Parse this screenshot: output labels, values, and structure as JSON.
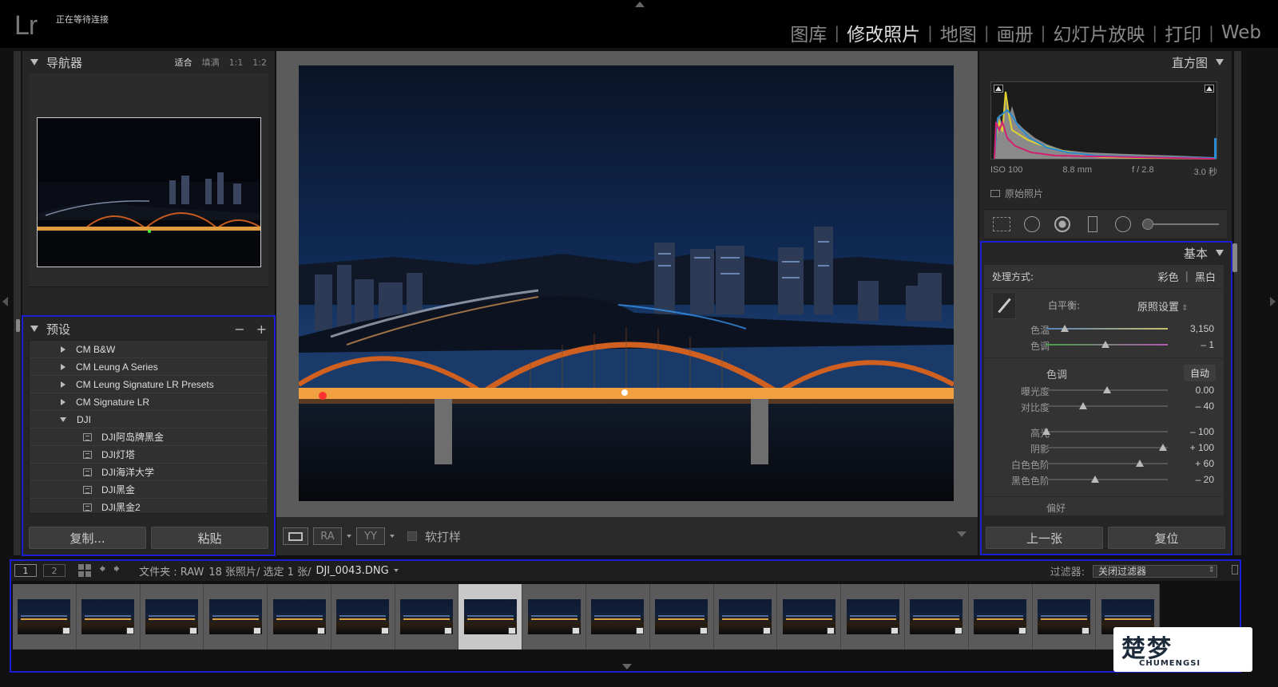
{
  "app": {
    "logo": "Lr",
    "identity_status": "正在等待连接"
  },
  "modules": [
    {
      "label": "图库",
      "active": false
    },
    {
      "label": "修改照片",
      "active": true
    },
    {
      "label": "地图",
      "active": false
    },
    {
      "label": "画册",
      "active": false
    },
    {
      "label": "幻灯片放映",
      "active": false
    },
    {
      "label": "打印",
      "active": false
    },
    {
      "label": "Web",
      "active": false
    }
  ],
  "navigator": {
    "title": "导航器",
    "zoom_fit": "适合",
    "zoom_fill": "填满",
    "zoom_1_1": "1:1",
    "zoom_1_2": "1:2",
    "zoom_caret": "⇕"
  },
  "presets": {
    "title": "预设",
    "remove": "−",
    "add": "+",
    "items": [
      {
        "label": "CM B&W",
        "kind": "folder-collapsed"
      },
      {
        "label": "CM Leung A Series",
        "kind": "folder-collapsed"
      },
      {
        "label": "CM Leung Signature  LR Presets",
        "kind": "folder-collapsed"
      },
      {
        "label": "CM Signature LR",
        "kind": "folder-collapsed"
      },
      {
        "label": "DJI",
        "kind": "folder-expanded"
      },
      {
        "label": "DJI阿岛牌黑金",
        "kind": "preset"
      },
      {
        "label": "DJI灯塔",
        "kind": "preset"
      },
      {
        "label": "DJI海洋大学",
        "kind": "preset"
      },
      {
        "label": "DJI黑金",
        "kind": "preset"
      },
      {
        "label": "DJI黑金2",
        "kind": "preset"
      }
    ],
    "copy_label": "复制...",
    "paste_label": "粘贴"
  },
  "toolbar": {
    "view_btn2": "RA",
    "view_btn3": "YY",
    "softproof_label": "软打样"
  },
  "histogram": {
    "title": "直方图",
    "iso": "ISO 100",
    "focal": "8.8 mm",
    "aperture": "f / 2.8",
    "shutter": "3.0 秒",
    "original_photo_label": "原始照片"
  },
  "basic": {
    "title": "基本",
    "treatment_label": "处理方式:",
    "treatment_color": "彩色",
    "treatment_bw": "黑白",
    "wb_label": "白平衡:",
    "wb_value": "原照设置",
    "temp": {
      "label": "色温",
      "value": "3,150",
      "pos": 0.15
    },
    "tint": {
      "label": "色调",
      "value": "– 1",
      "pos": 0.49
    },
    "tone_label": "色调",
    "auto_label": "自动",
    "exposure": {
      "label": "曝光度",
      "value": "0.00",
      "pos": 0.5
    },
    "contrast": {
      "label": "对比度",
      "value": "– 40",
      "pos": 0.3
    },
    "highlights": {
      "label": "高光",
      "value": "– 100",
      "pos": 0.0
    },
    "shadows": {
      "label": "阴影",
      "value": "+ 100",
      "pos": 0.96
    },
    "whites": {
      "label": "白色色阶",
      "value": "+ 60",
      "pos": 0.77
    },
    "blacks": {
      "label": "黑色色阶",
      "value": "– 20",
      "pos": 0.4
    },
    "presence_label": "偏好"
  },
  "right_buttons": {
    "prev_label": "上一张",
    "reset_label": "复位"
  },
  "filmstrip": {
    "page1": "1",
    "page2": "2",
    "path_prefix": "文件夹 : RAW",
    "count_text": "18 张照片/ 选定 1 张/",
    "filename": "DJI_0043.DNG",
    "filter_label": "过滤器:",
    "filter_value": "关闭过滤器",
    "selected_index": 7
  },
  "watermark": {
    "big": "楚梦",
    "small": "CHUMENGSI"
  }
}
